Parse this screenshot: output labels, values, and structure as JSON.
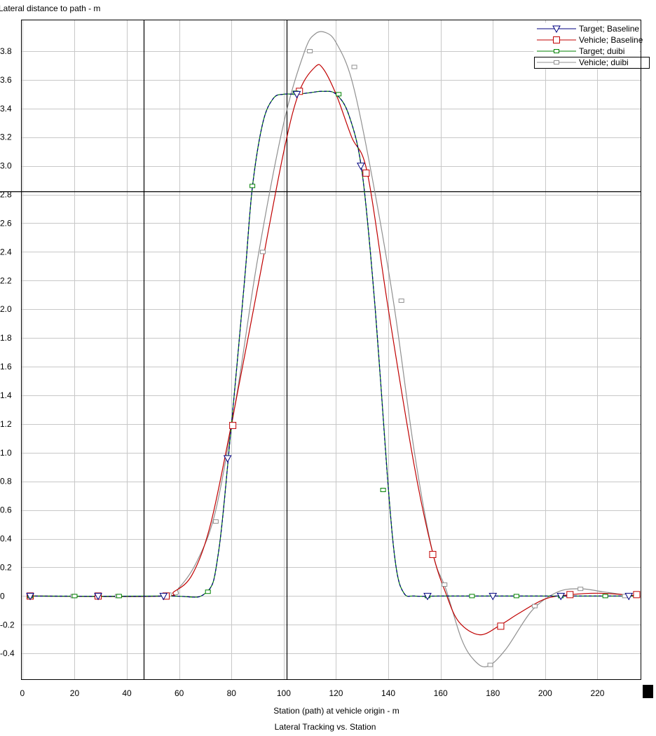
{
  "chart_data": {
    "type": "line",
    "title": "Lateral Tracking vs. Station",
    "xlabel": "Station (path) at vehicle origin - m",
    "ylabel": "Lateral distance to path - m",
    "xlim": [
      -0.5,
      236.5
    ],
    "ylim": [
      -0.58,
      4.02
    ],
    "xticks": [
      0,
      20,
      40,
      60,
      80,
      100,
      120,
      140,
      160,
      180,
      200,
      220
    ],
    "yticks": [
      -0.4,
      -0.2,
      0,
      0.2,
      0.4,
      0.6,
      0.8,
      1.0,
      1.2,
      1.4,
      1.6,
      1.8,
      2.0,
      2.2,
      2.4,
      2.6,
      2.8,
      3.0,
      3.2,
      3.4,
      3.6,
      3.8
    ],
    "ytick_labels": [
      "-0.4",
      "-0.2",
      "0",
      "0.2",
      "0.4",
      "0.6",
      "0.8",
      "1.0",
      "1.2",
      "1.4",
      "1.6",
      "1.8",
      "2.0",
      "2.2",
      "2.4",
      "2.6",
      "2.8",
      "3.0",
      "3.2",
      "3.4",
      "3.6",
      "3.8"
    ],
    "grid": true,
    "legend_position": "top-right",
    "cursor": {
      "x": [
        46.5,
        101.2
      ],
      "y": 2.82
    },
    "series": [
      {
        "name": "Target; Baseline",
        "color": "#000080",
        "marker": "triangle-down",
        "x": [
          3,
          55,
          70,
          75,
          80,
          85,
          88,
          92,
          96,
          100,
          105,
          110,
          115,
          120,
          125,
          130,
          135,
          140,
          143,
          146,
          150,
          160,
          180,
          200,
          210,
          220,
          236
        ],
        "y": [
          0,
          0,
          0.02,
          0.3,
          1.2,
          2.2,
          2.85,
          3.3,
          3.47,
          3.5,
          3.5,
          3.51,
          3.52,
          3.5,
          3.35,
          2.95,
          2.0,
          0.75,
          0.2,
          0.02,
          0,
          0,
          0,
          0,
          0,
          0,
          0
        ],
        "marker_x": [
          3,
          29,
          54,
          78.5,
          105,
          129.5,
          155,
          180,
          206,
          232
        ],
        "marker_y": [
          0,
          0,
          0,
          0.96,
          3.5,
          3.0,
          0,
          0,
          0,
          0
        ]
      },
      {
        "name": "Vehicle; Baseline",
        "color": "#c00000",
        "marker": "square",
        "x": [
          3,
          53,
          58,
          65,
          72,
          80,
          90,
          100,
          106,
          112,
          115,
          120,
          126,
          132,
          140,
          150,
          157,
          162,
          167,
          175,
          183,
          190,
          200,
          210,
          220,
          230,
          236
        ],
        "y": [
          0,
          0,
          0.03,
          0.15,
          0.5,
          1.2,
          2.15,
          3.1,
          3.52,
          3.69,
          3.68,
          3.5,
          3.2,
          2.95,
          2.0,
          0.9,
          0.3,
          0.02,
          -0.18,
          -0.27,
          -0.2,
          -0.12,
          -0.02,
          0.01,
          0.02,
          0.01,
          0
        ],
        "marker_x": [
          3,
          29,
          55,
          80.5,
          106,
          131.5,
          157,
          183,
          209.5,
          235
        ],
        "marker_y": [
          0,
          0,
          0,
          1.19,
          3.52,
          2.95,
          0.29,
          -0.21,
          0.01,
          0.01
        ]
      },
      {
        "name": "Target; duibi",
        "color": "#008000",
        "marker": "square-small",
        "x": [
          3,
          55,
          70,
          75,
          80,
          85,
          88,
          92,
          96,
          100,
          105,
          110,
          115,
          120,
          125,
          130,
          135,
          140,
          143,
          146,
          150,
          160,
          180,
          200,
          210,
          220,
          236
        ],
        "y": [
          0,
          0,
          0.02,
          0.3,
          1.2,
          2.2,
          2.85,
          3.3,
          3.47,
          3.5,
          3.5,
          3.51,
          3.52,
          3.5,
          3.35,
          2.95,
          2.0,
          0.75,
          0.2,
          0.02,
          0,
          0,
          0,
          0,
          0,
          0,
          0
        ],
        "marker_x": [
          3,
          20,
          37,
          71,
          88,
          104.5,
          121,
          138,
          155,
          172,
          189,
          206,
          223
        ],
        "marker_y": [
          0,
          0,
          0,
          0.03,
          2.86,
          3.51,
          3.5,
          0.74,
          0,
          0,
          0,
          0,
          0
        ]
      },
      {
        "name": "Vehicle; duibi",
        "color": "#909090",
        "marker": "square-small",
        "x": [
          3,
          54,
          60,
          67,
          74,
          82,
          90,
          100,
          108,
          112,
          116,
          120,
          126,
          133,
          142,
          150,
          157,
          162,
          168,
          173,
          178,
          185,
          195,
          205,
          214,
          222,
          230,
          236
        ],
        "y": [
          0,
          0,
          0.06,
          0.25,
          0.6,
          1.4,
          2.35,
          3.3,
          3.8,
          3.92,
          3.93,
          3.86,
          3.6,
          3.0,
          2.05,
          1.0,
          0.3,
          0.05,
          -0.3,
          -0.45,
          -0.49,
          -0.37,
          -0.1,
          0.03,
          0.05,
          0.03,
          0.01,
          0
        ],
        "marker_x": [
          3,
          19.5,
          36.5,
          56,
          74,
          92,
          110,
          127,
          145,
          161.5,
          179,
          196,
          213.5,
          230.5
        ],
        "marker_y": [
          0,
          0,
          0,
          0.01,
          0.52,
          2.4,
          3.8,
          3.69,
          2.06,
          0.08,
          -0.48,
          -0.07,
          0.05,
          0
        ]
      }
    ]
  }
}
